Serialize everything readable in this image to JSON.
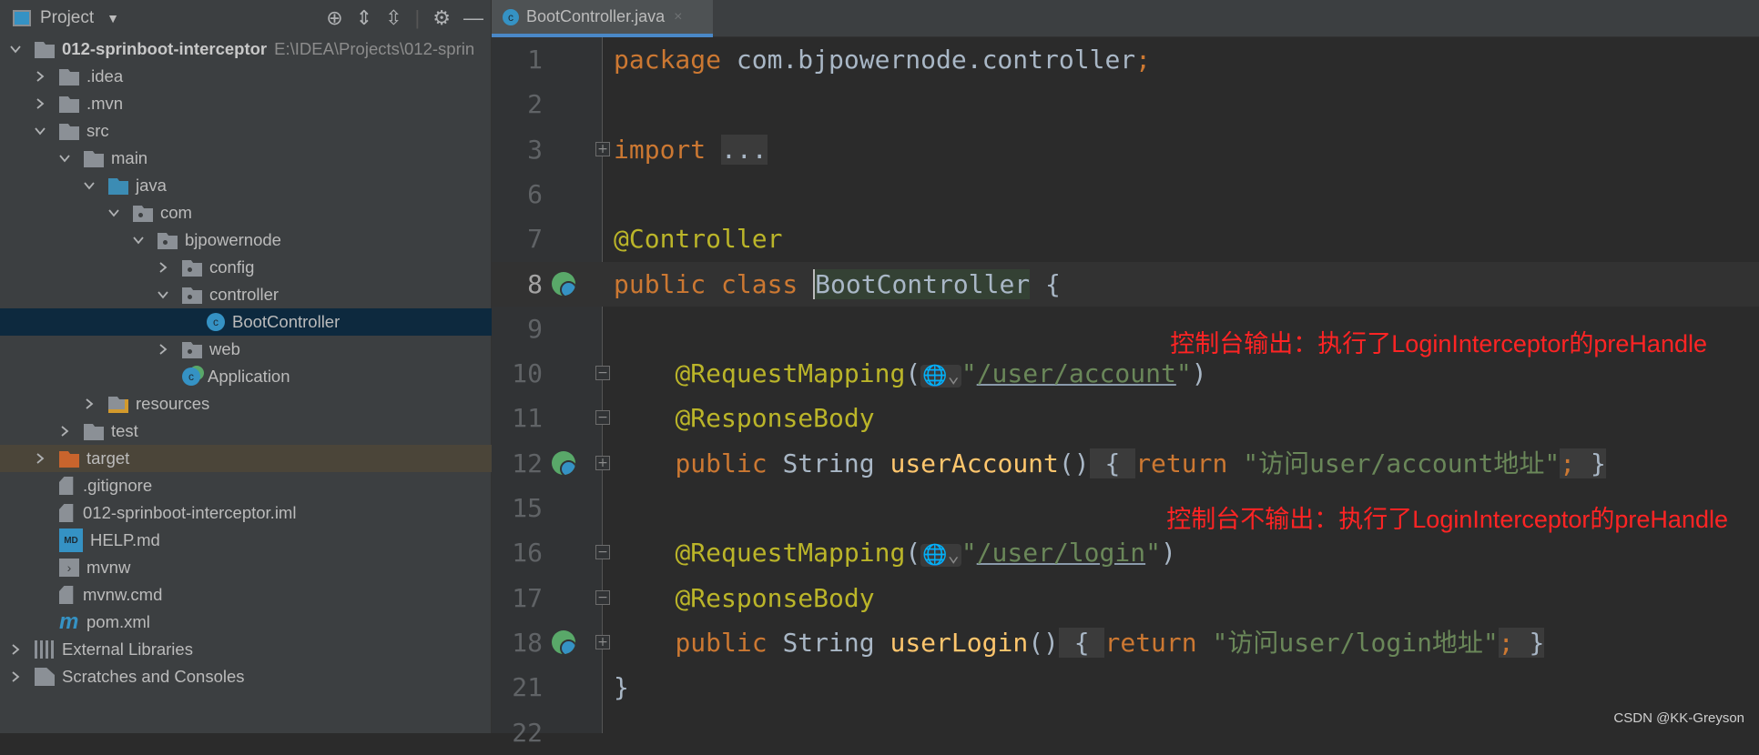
{
  "sidebar": {
    "title": "Project",
    "tools": [
      "locate-icon",
      "expand-all-icon",
      "collapse-all-icon",
      "gear-icon",
      "minimize-icon"
    ],
    "tree": [
      {
        "label": "012-sprinboot-interceptor",
        "path": "E:\\IDEA\\Projects\\012-sprin",
        "level": 0,
        "chevron": "down",
        "icon": "module",
        "bold": true
      },
      {
        "label": ".idea",
        "level": 1,
        "chevron": "right",
        "icon": "folder"
      },
      {
        "label": ".mvn",
        "level": 1,
        "chevron": "right",
        "icon": "folder"
      },
      {
        "label": "src",
        "level": 1,
        "chevron": "down",
        "icon": "folder"
      },
      {
        "label": "main",
        "level": 2,
        "chevron": "down",
        "icon": "folder"
      },
      {
        "label": "java",
        "level": 3,
        "chevron": "down",
        "icon": "source-folder"
      },
      {
        "label": "com",
        "level": 4,
        "chevron": "down",
        "icon": "package"
      },
      {
        "label": "bjpowernode",
        "level": 5,
        "chevron": "down",
        "icon": "package"
      },
      {
        "label": "config",
        "level": 6,
        "chevron": "right",
        "icon": "package"
      },
      {
        "label": "controller",
        "level": 6,
        "chevron": "down",
        "icon": "package"
      },
      {
        "label": "BootController",
        "level": 7,
        "chevron": "none",
        "icon": "class",
        "selected": true
      },
      {
        "label": "web",
        "level": 6,
        "chevron": "right",
        "icon": "package"
      },
      {
        "label": "Application",
        "level": 6,
        "chevron": "none",
        "icon": "spring-boot-class"
      },
      {
        "label": "resources",
        "level": 3,
        "chevron": "right",
        "icon": "resources-folder"
      },
      {
        "label": "test",
        "level": 2,
        "chevron": "right",
        "icon": "folder"
      },
      {
        "label": "target",
        "level": 1,
        "chevron": "right",
        "icon": "excluded-folder",
        "excluded": true
      },
      {
        "label": ".gitignore",
        "level": 1,
        "chevron": "none",
        "icon": "ignore-file"
      },
      {
        "label": "012-sprinboot-interceptor.iml",
        "level": 1,
        "chevron": "none",
        "icon": "iml-file"
      },
      {
        "label": "HELP.md",
        "level": 1,
        "chevron": "none",
        "icon": "markdown-file"
      },
      {
        "label": "mvnw",
        "level": 1,
        "chevron": "none",
        "icon": "shell-file"
      },
      {
        "label": "mvnw.cmd",
        "level": 1,
        "chevron": "none",
        "icon": "text-file"
      },
      {
        "label": "pom.xml",
        "level": 1,
        "chevron": "none",
        "icon": "maven-file"
      },
      {
        "label": "External Libraries",
        "level": 0,
        "chevron": "right",
        "icon": "libraries"
      },
      {
        "label": "Scratches and Consoles",
        "level": 0,
        "chevron": "right",
        "icon": "scratches"
      }
    ]
  },
  "editor": {
    "tab": {
      "label": "BootController.java",
      "close": "×"
    },
    "lines": [
      {
        "n": "1",
        "tokens": [
          [
            "kw",
            "package "
          ],
          [
            "",
            "com.bjpowernode.controller"
          ],
          [
            "kw",
            ";"
          ]
        ]
      },
      {
        "n": "2",
        "tokens": []
      },
      {
        "n": "3",
        "fold": "+",
        "tokens": [
          [
            "kw",
            "import "
          ],
          [
            "fb",
            "..."
          ]
        ]
      },
      {
        "n": "6",
        "tokens": []
      },
      {
        "n": "7",
        "tokens": [
          [
            "ann",
            "@Controller"
          ]
        ]
      },
      {
        "n": "8",
        "current": true,
        "gutter": "spring-bean-icon",
        "tokens": [
          [
            "kw",
            "public class "
          ],
          [
            "hl caret",
            "BootController"
          ],
          [
            "",
            " {"
          ]
        ]
      },
      {
        "n": "9",
        "tokens": []
      },
      {
        "n": "10",
        "fold": "−",
        "tokens": [
          [
            "",
            "    "
          ],
          [
            "ann",
            "@RequestMapping"
          ],
          [
            "",
            "("
          ],
          [
            "hint",
            "🌐⌄"
          ],
          [
            "str",
            "\""
          ],
          [
            "link",
            "/user/account"
          ],
          [
            "str",
            "\""
          ],
          [
            "",
            ")"
          ]
        ]
      },
      {
        "n": "11",
        "fold": "−",
        "tokens": [
          [
            "",
            "    "
          ],
          [
            "ann",
            "@ResponseBody"
          ]
        ]
      },
      {
        "n": "12",
        "fold": "+",
        "gutter": "web-endpoint-icon",
        "tokens": [
          [
            "",
            "    "
          ],
          [
            "kw",
            "public "
          ],
          [
            "",
            "String "
          ],
          [
            "mth",
            "userAccount"
          ],
          [
            "",
            "()"
          ],
          [
            "fb",
            " { "
          ],
          [
            "kw",
            "return "
          ],
          [
            "str",
            "\"访问user/account地址\""
          ],
          [
            "fb kw",
            "; "
          ],
          [
            "fb",
            "}"
          ]
        ]
      },
      {
        "n": "15",
        "tokens": []
      },
      {
        "n": "16",
        "fold": "−",
        "tokens": [
          [
            "",
            "    "
          ],
          [
            "ann",
            "@RequestMapping"
          ],
          [
            "",
            "("
          ],
          [
            "hint",
            "🌐⌄"
          ],
          [
            "str",
            "\""
          ],
          [
            "link",
            "/user/login"
          ],
          [
            "str",
            "\""
          ],
          [
            "",
            ")"
          ]
        ]
      },
      {
        "n": "17",
        "fold": "−",
        "tokens": [
          [
            "",
            "    "
          ],
          [
            "ann",
            "@ResponseBody"
          ]
        ]
      },
      {
        "n": "18",
        "fold": "+",
        "gutter": "web-endpoint-icon",
        "tokens": [
          [
            "",
            "    "
          ],
          [
            "kw",
            "public "
          ],
          [
            "",
            "String "
          ],
          [
            "mth",
            "userLogin"
          ],
          [
            "",
            "()"
          ],
          [
            "fb",
            " { "
          ],
          [
            "kw",
            "return "
          ],
          [
            "str",
            "\"访问user/login地址\""
          ],
          [
            "fb kw",
            "; "
          ],
          [
            "fb",
            "}"
          ]
        ]
      },
      {
        "n": "21",
        "tokens": [
          [
            "",
            "}"
          ]
        ]
      },
      {
        "n": "22",
        "tokens": []
      }
    ]
  },
  "annotations": [
    {
      "text": "控制台输出：执行了LoginInterceptor的preHandle",
      "color": "#ff2424"
    },
    {
      "text": "控制台不输出：执行了LoginInterceptor的preHandle",
      "color": "#ff2424"
    }
  ],
  "watermark": "CSDN @KK-Greyson"
}
